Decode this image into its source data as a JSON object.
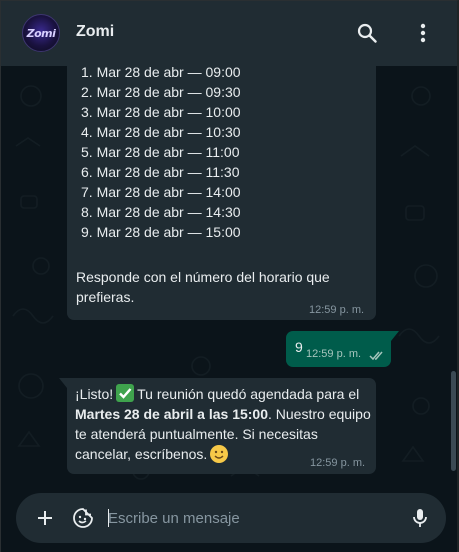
{
  "header": {
    "avatar_text": "Zomi",
    "contact_name": "Zomi",
    "search_icon": "search-icon",
    "menu_icon": "more-vertical-icon"
  },
  "messages": {
    "slots_list": [
      "1.  Mar 28 de abr — 09:00",
      "2.  Mar 28 de abr — 09:30",
      "3.  Mar 28 de abr — 10:00",
      "4.  Mar 28 de abr — 10:30",
      "5.  Mar 28 de abr — 11:00",
      "6.  Mar 28 de abr — 11:30",
      "7.  Mar 28 de abr — 14:00",
      "8.  Mar 28 de abr — 14:30",
      "9.  Mar 28 de abr — 15:00"
    ],
    "slots_prompt": "Responde con el número del horario que prefieras.",
    "slots_time": "12:59 p. m.",
    "reply_text": "9",
    "reply_time": "12:59 p. m.",
    "confirm_part1": "¡Listo!",
    "confirm_part2": "Tu reunión quedó agendada para el",
    "confirm_bold": "Martes 28 de abril a las 15:00",
    "confirm_part3": ". Nuestro equipo te atenderá puntualmente. Si necesitas cancelar, escríbenos.",
    "confirm_time": "12:59 p. m."
  },
  "composer": {
    "placeholder": "Escribe un mensaje",
    "plus_icon": "plus-icon",
    "sticker_icon": "sticker-icon",
    "mic_icon": "mic-icon"
  },
  "colors": {
    "header_bg": "#202c33",
    "chat_bg": "#0b141a",
    "incoming_bubble": "#202c33",
    "outgoing_bubble": "#005c4b",
    "timestamp": "#8696a0"
  }
}
